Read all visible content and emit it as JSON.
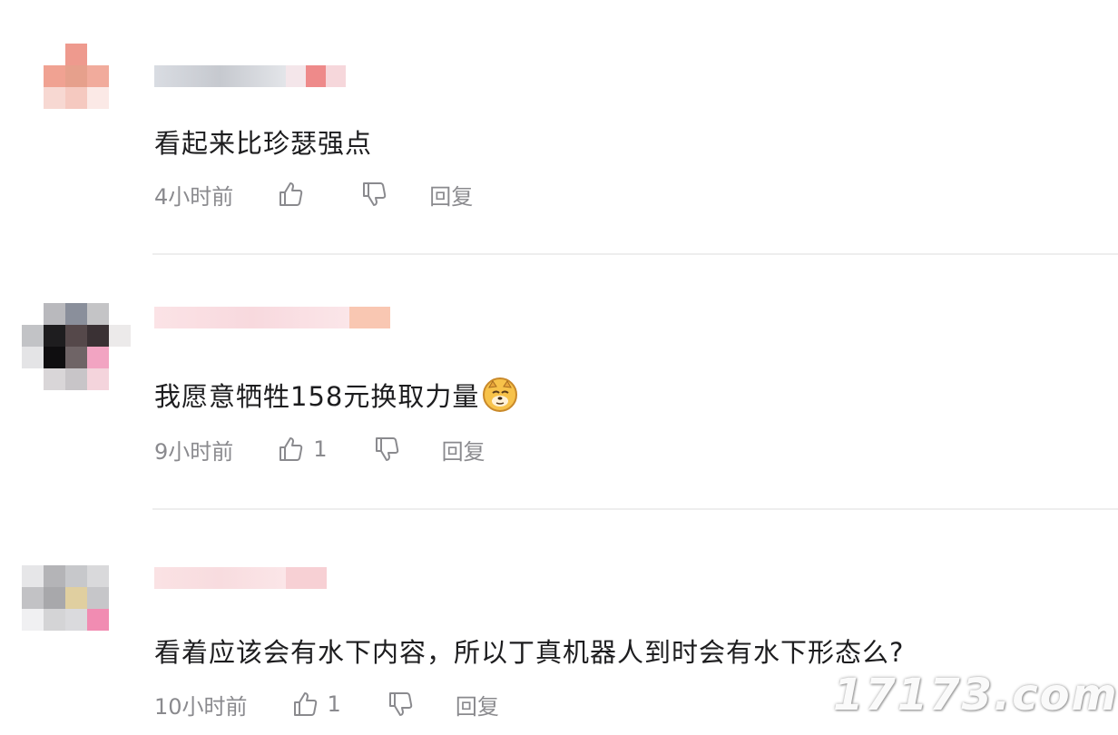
{
  "colors": {
    "background": "#ffffff",
    "text": "#1d1d1f",
    "meta": "#8a8a8e",
    "divider": "#eeeeee"
  },
  "comments": [
    {
      "text": "看起来比珍瑟强点",
      "time": "4小时前",
      "likes": "",
      "reply_label": "回复",
      "avatar_icon": "pixelated-avatar",
      "like_icon": "thumbs-up-icon",
      "dislike_icon": "thumbs-down-icon"
    },
    {
      "text": "我愿意牺牲158元换取力量",
      "emoji": "doge-emoji",
      "time": "9小时前",
      "likes": "1",
      "reply_label": "回复",
      "avatar_icon": "pixelated-avatar",
      "like_icon": "thumbs-up-icon",
      "dislike_icon": "thumbs-down-icon"
    },
    {
      "text": "看着应该会有水下内容，所以丁真机器人到时会有水下形态么?",
      "time": "10小时前",
      "likes": "1",
      "reply_label": "回复",
      "avatar_icon": "pixelated-avatar",
      "like_icon": "thumbs-up-icon",
      "dislike_icon": "thumbs-down-icon"
    }
  ],
  "watermark": "17173.com"
}
